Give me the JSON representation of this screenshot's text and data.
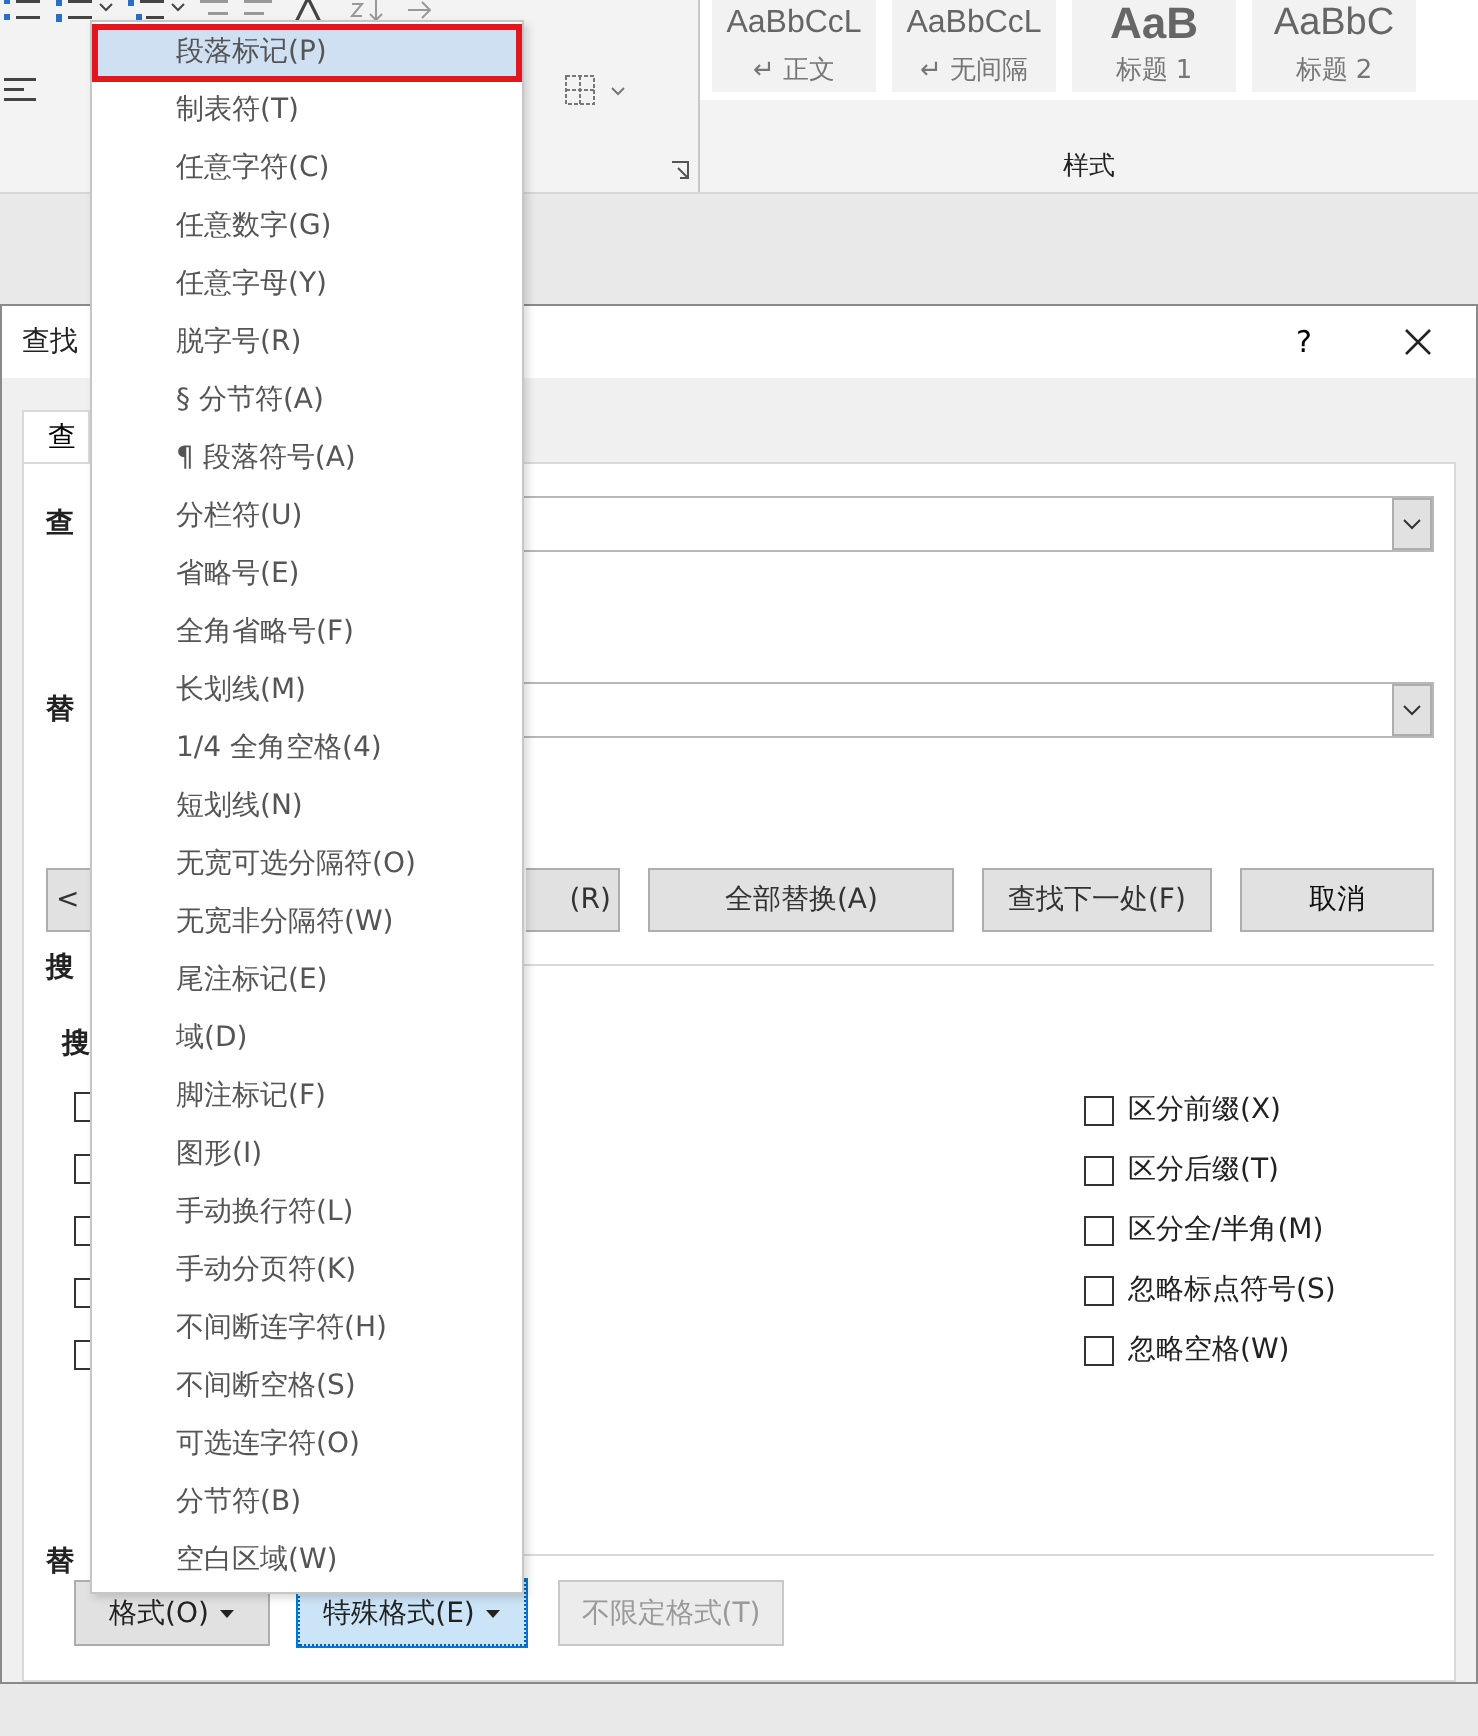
{
  "ribbon": {
    "styles": [
      {
        "preview": "AaBbCcL",
        "name": "↵ 正文",
        "kind": "normal"
      },
      {
        "preview": "AaBbCcL",
        "name": "↵ 无间隔",
        "kind": "normal"
      },
      {
        "preview": "AaB",
        "name": "标题 1",
        "kind": "heading"
      },
      {
        "preview": "AaBbC",
        "name": "标题 2",
        "kind": "subheading"
      }
    ],
    "group_label": "样式"
  },
  "dialog": {
    "title": "查找",
    "help": "?",
    "tab": {
      "label": "查",
      "selected": true
    },
    "find_label": "查",
    "replace_label": "替",
    "buttons": [
      {
        "label": "<",
        "kind": "partial"
      },
      {
        "label": "(R)",
        "kind": "partial"
      },
      {
        "label": "全部替换(A)",
        "kind": "normal"
      },
      {
        "label": "查找下一处(F)",
        "kind": "normal"
      },
      {
        "label": "取消",
        "kind": "normal"
      }
    ],
    "search_label": "搜",
    "search_sub_label": "搜",
    "left_checkboxes": [
      {
        "checked": false
      },
      {
        "checked": false
      },
      {
        "checked": false
      },
      {
        "checked": false
      },
      {
        "checked": false
      }
    ],
    "right_checkboxes": [
      {
        "label": "区分前缀(X)",
        "checked": false
      },
      {
        "label": "区分后缀(T)",
        "checked": false
      },
      {
        "label": "区分全/半角(M)",
        "checked": false
      },
      {
        "label": "忽略标点符号(S)",
        "checked": false
      },
      {
        "label": "忽略空格(W)",
        "checked": false
      }
    ],
    "replace_section_label": "替",
    "bottom_buttons": [
      {
        "label": "格式(O)",
        "selected": false,
        "disabled": false,
        "dropdown": true
      },
      {
        "label": "特殊格式(E)",
        "selected": true,
        "disabled": false,
        "dropdown": true
      },
      {
        "label": "不限定格式(T)",
        "selected": false,
        "disabled": true,
        "dropdown": false
      }
    ]
  },
  "menu": {
    "items": [
      {
        "label": "段落标记(P)",
        "selected": true
      },
      {
        "label": "制表符(T)",
        "selected": false
      },
      {
        "label": "任意字符(C)",
        "selected": false
      },
      {
        "label": "任意数字(G)",
        "selected": false
      },
      {
        "label": "任意字母(Y)",
        "selected": false
      },
      {
        "label": "脱字号(R)",
        "selected": false
      },
      {
        "label": "§ 分节符(A)",
        "selected": false
      },
      {
        "label": "¶ 段落符号(A)",
        "selected": false
      },
      {
        "label": "分栏符(U)",
        "selected": false
      },
      {
        "label": "省略号(E)",
        "selected": false
      },
      {
        "label": "全角省略号(F)",
        "selected": false
      },
      {
        "label": "长划线(M)",
        "selected": false
      },
      {
        "label": "1/4 全角空格(4)",
        "selected": false
      },
      {
        "label": "短划线(N)",
        "selected": false
      },
      {
        "label": "无宽可选分隔符(O)",
        "selected": false
      },
      {
        "label": "无宽非分隔符(W)",
        "selected": false
      },
      {
        "label": "尾注标记(E)",
        "selected": false
      },
      {
        "label": "域(D)",
        "selected": false
      },
      {
        "label": "脚注标记(F)",
        "selected": false
      },
      {
        "label": "图形(I)",
        "selected": false
      },
      {
        "label": "手动换行符(L)",
        "selected": false
      },
      {
        "label": "手动分页符(K)",
        "selected": false
      },
      {
        "label": "不间断连字符(H)",
        "selected": false
      },
      {
        "label": "不间断空格(S)",
        "selected": false
      },
      {
        "label": "可选连字符(O)",
        "selected": false
      },
      {
        "label": "分节符(B)",
        "selected": false
      },
      {
        "label": "空白区域(W)",
        "selected": false
      }
    ]
  }
}
